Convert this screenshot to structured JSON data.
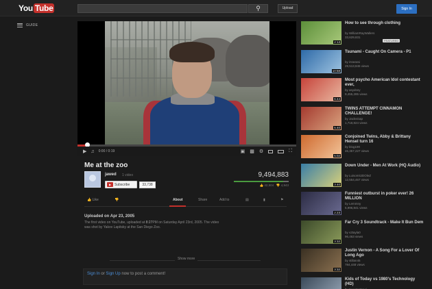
{
  "header": {
    "logo_you": "You",
    "logo_tube": "Tube",
    "search_placeholder": "",
    "search_icon": "search-icon",
    "upload_label": "Upload",
    "signin_label": "Sign In"
  },
  "guide": {
    "label": "GUIDE"
  },
  "player": {
    "time_current": "0:00",
    "time_total": "0:19",
    "progress": 0.04
  },
  "video": {
    "title": "Me at the zoo",
    "channel": "jawed",
    "channel_videos": "1 video",
    "subscribe_label": "Subscribe",
    "subscriber_count": "33,738",
    "views": "9,494,883",
    "likes": "42,504",
    "dislikes": "4,943",
    "like_ratio": 0.9
  },
  "actions": {
    "like": "Like",
    "about": "About",
    "share": "Share",
    "add_to": "Add to"
  },
  "description": {
    "uploaded": "Uploaded on Apr 23, 2005",
    "line1": "The first video on YouTube, uploaded at ",
    "time": "8:27",
    "line2": "PM on Saturday April 23rd, 2005. The video was shot by Yakov Lapitsky at the San Diego Zoo.",
    "show_more": "Show more"
  },
  "comments": {
    "sign_in": "Sign In",
    "or": "or",
    "sign_up": "Sign Up",
    "rest": "now to post a comment!"
  },
  "sidebar": [
    {
      "title": "How to see through clothing",
      "by": "by WilliamRayWallers",
      "views": "33,629,831",
      "duration": "2:13",
      "badge": "FEATURED"
    },
    {
      "title": "Tsunami - Caught On Camera - P1",
      "by": "by insearai",
      "views": "29,513,845 views",
      "duration": "10:58"
    },
    {
      "title": "Most psycho American Idol contestant ever,",
      "by": "by asydsny",
      "views": "9,455,285 views",
      "duration": "6:44"
    },
    {
      "title": "TWINS ATTEMPT CINNAMON CHALLENGE!",
      "by": "by JacksGap",
      "views": "1,718,824 views",
      "duration": "5:40"
    },
    {
      "title": "Conjoined Twins, Abby & Brittany Hensel turn 16",
      "by": "by blog190",
      "views": "46,357,227 views",
      "duration": "5:02"
    },
    {
      "title": "Down Under - Men At Work (HQ Audio)",
      "by": "by LuisomitJDOleZ",
      "views": "12,554,467 views",
      "duration": "3:40"
    },
    {
      "title": "Funniest outburst in poker ever! 26 MILLION",
      "by": "by Lemmny",
      "views": "5,996,841 views",
      "duration": "2:23"
    },
    {
      "title": "Far Cry 3 Soundtrack - Make It Bun Dem",
      "by": "by v2tayla0",
      "views": "96,463 views",
      "duration": "3:32"
    },
    {
      "title": "Justin Vernon - A Song For a Lover Of Long Ago",
      "by": "by stillan45",
      "views": "784,448 views",
      "duration": "3:32"
    },
    {
      "title": "Kids of Today vs 1980's Technology (HD)",
      "by": "by InvestorSewi",
      "views": "",
      "duration": ""
    }
  ]
}
